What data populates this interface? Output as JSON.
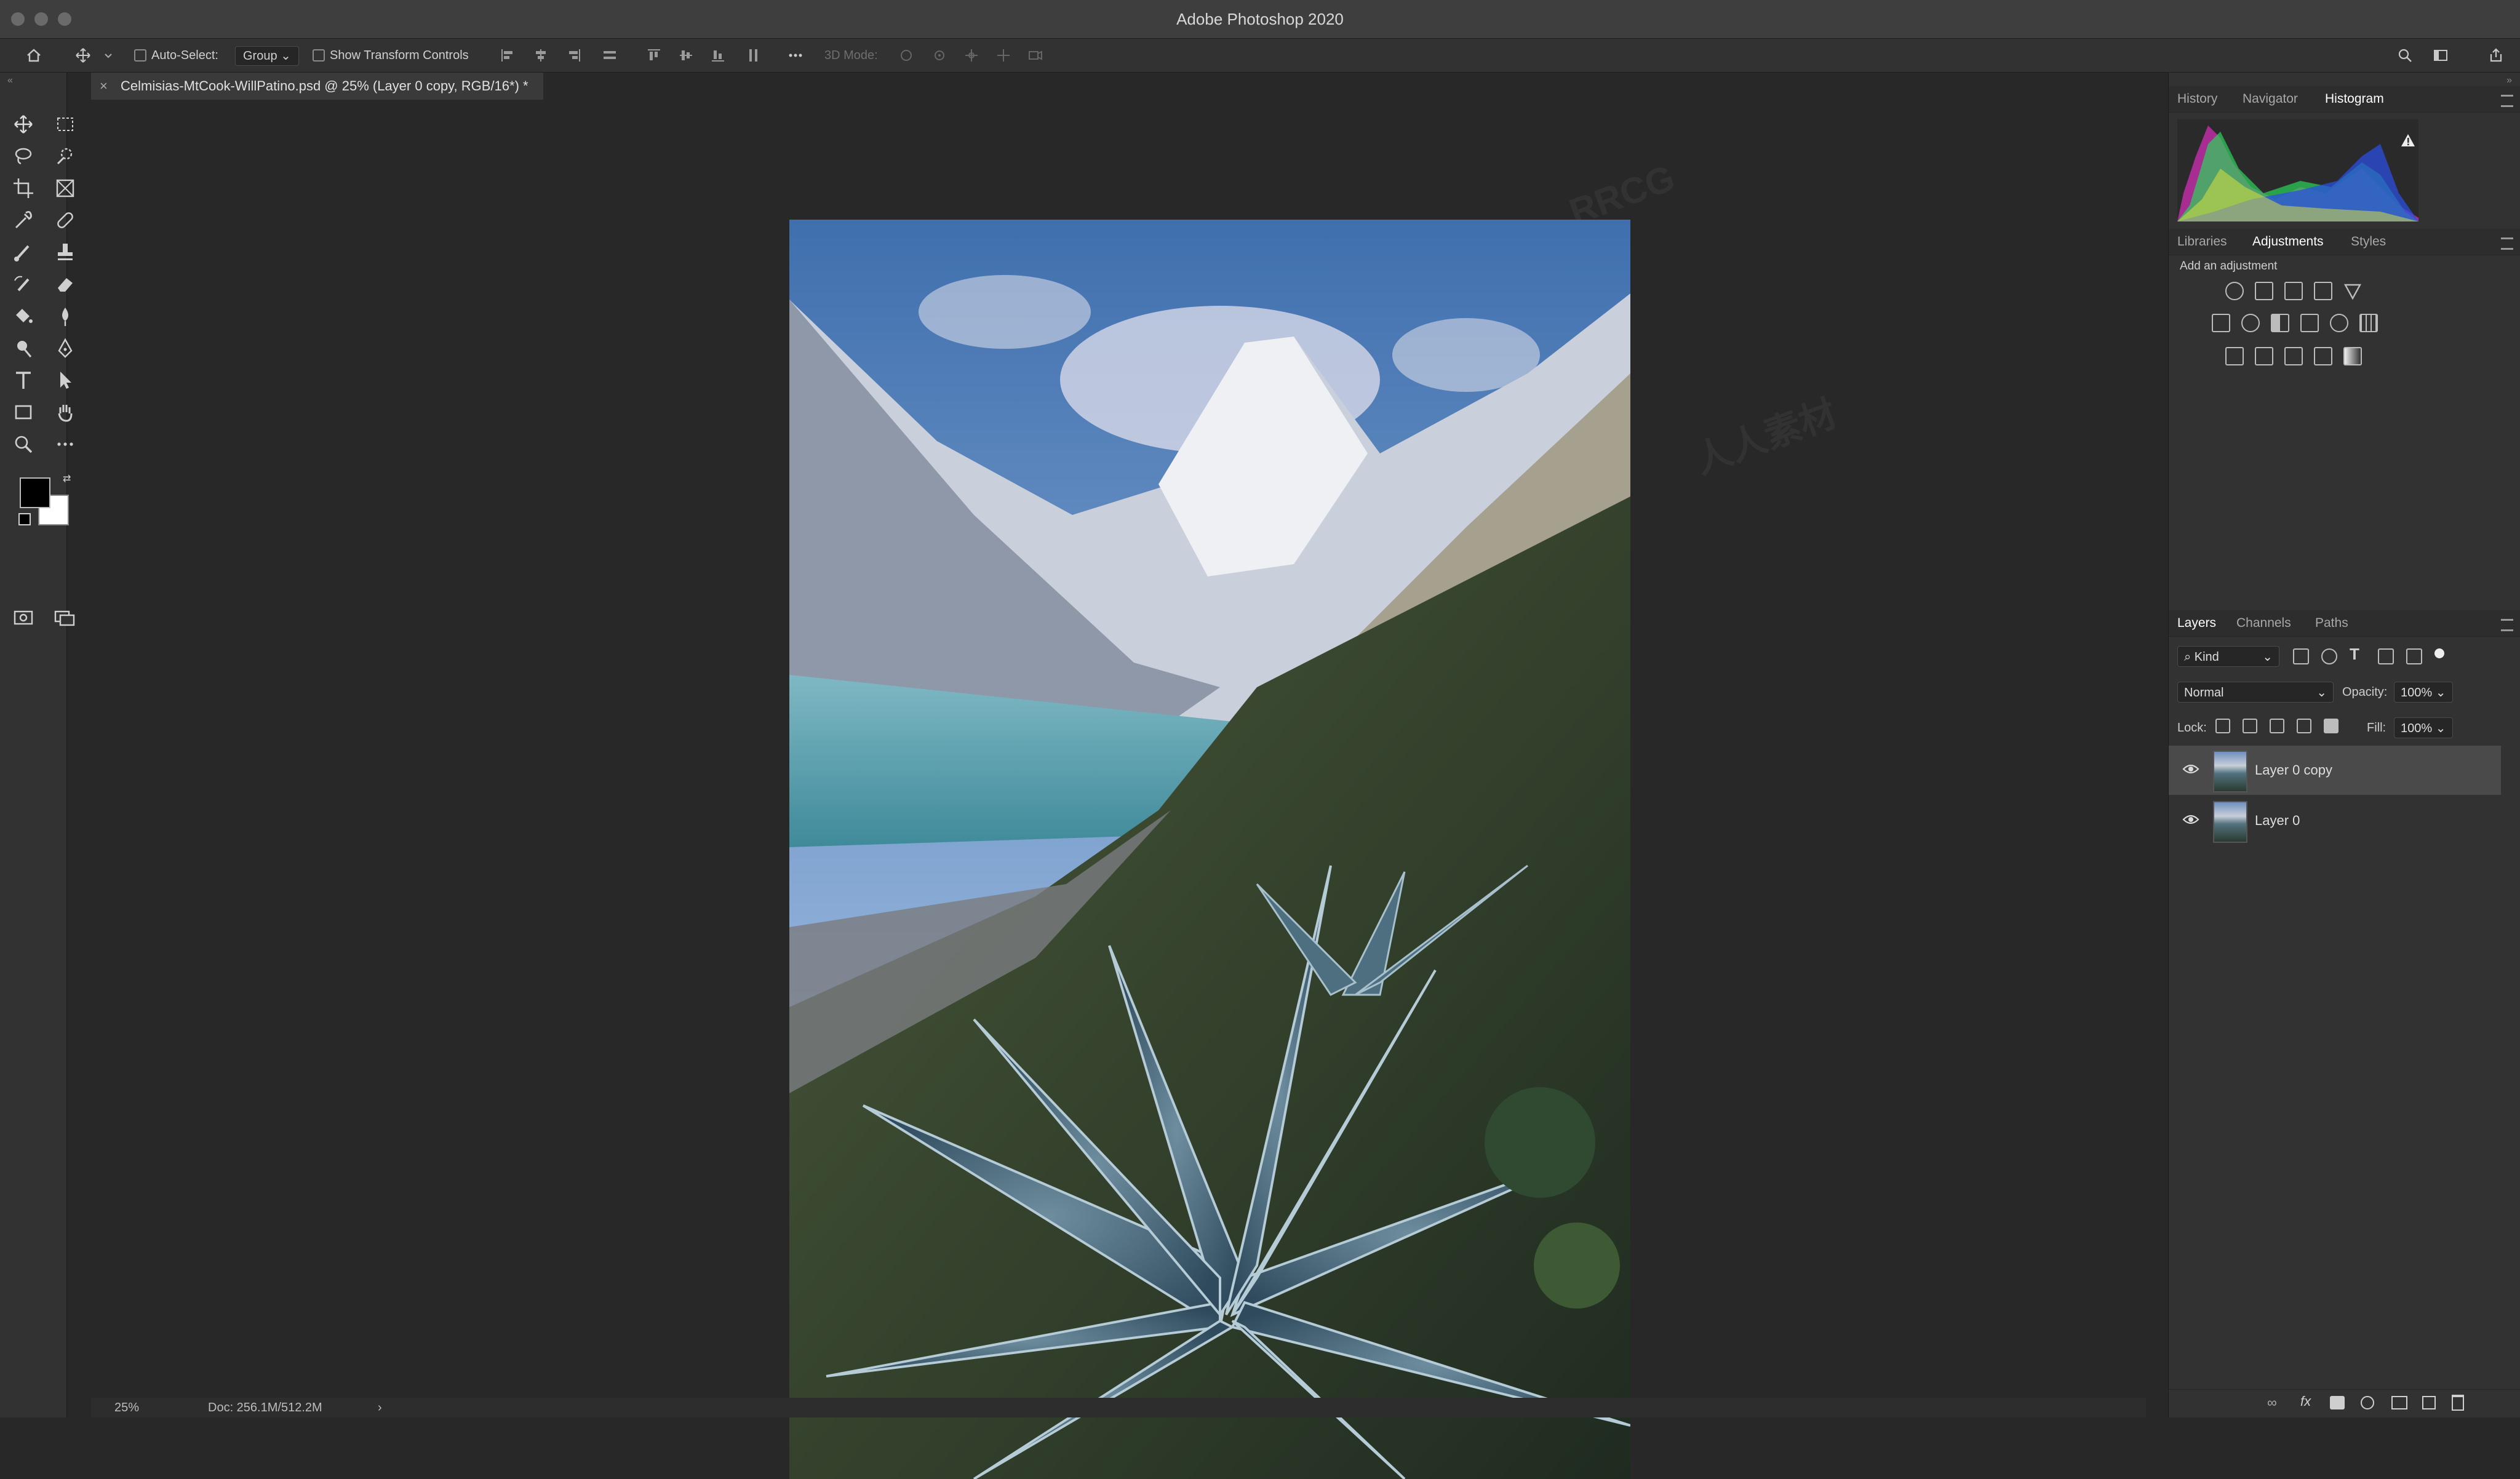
{
  "app": {
    "title": "Adobe Photoshop 2020"
  },
  "options_bar": {
    "auto_select_label": "Auto-Select:",
    "auto_select_value": "Group",
    "show_transform_label": "Show Transform Controls",
    "mode_3d_label": "3D Mode:"
  },
  "document": {
    "tab_title": "Celmisias-MtCook-WillPatino.psd @ 25% (Layer 0 copy, RGB/16*) *",
    "close_glyph": "×"
  },
  "status": {
    "zoom": "25%",
    "doc_size": "Doc: 256.1M/512.2M",
    "arrow": "›"
  },
  "panels": {
    "top_tabs": [
      "History",
      "Navigator",
      "Histogram"
    ],
    "active_top_tab": "Histogram",
    "mid_tabs": [
      "Libraries",
      "Adjustments",
      "Styles"
    ],
    "active_mid_tab": "Adjustments",
    "add_adjustment": "Add an adjustment",
    "layer_tabs": [
      "Layers",
      "Channels",
      "Paths"
    ],
    "active_layer_tab": "Layers",
    "filter_kind": "Kind",
    "blend_mode": "Normal",
    "opacity_label": "Opacity:",
    "opacity_value": "100%",
    "lock_label": "Lock:",
    "fill_label": "Fill:",
    "fill_value": "100%",
    "layers": [
      {
        "name": "Layer 0 copy",
        "selected": true
      },
      {
        "name": "Layer 0",
        "selected": false
      }
    ]
  },
  "watermark": {
    "text": "RRCG",
    "subtext": "人人素材"
  },
  "colors": {
    "accent_selected_layer": "#4a4a4a",
    "foreground": "#000000",
    "background": "#ffffff"
  }
}
